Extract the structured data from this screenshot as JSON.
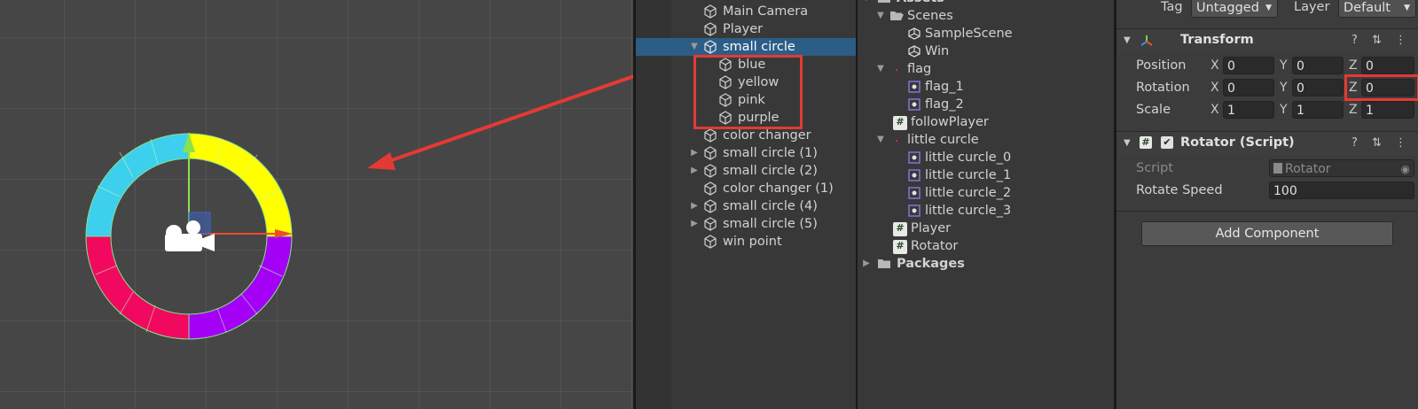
{
  "hierarchy": {
    "items": [
      {
        "label": "Main Camera"
      },
      {
        "label": "Player"
      },
      {
        "label": "small circle"
      },
      {
        "label": "blue"
      },
      {
        "label": "yellow"
      },
      {
        "label": "pink"
      },
      {
        "label": "purple"
      },
      {
        "label": "color changer"
      },
      {
        "label": "small circle (1)"
      },
      {
        "label": "small circle (2)"
      },
      {
        "label": "color changer (1)"
      },
      {
        "label": "small circle (4)"
      },
      {
        "label": "small circle (5)"
      },
      {
        "label": "win point"
      }
    ]
  },
  "project": {
    "root": "Assets",
    "items": [
      {
        "label": "Scenes"
      },
      {
        "label": "SampleScene"
      },
      {
        "label": "Win"
      },
      {
        "label": "flag"
      },
      {
        "label": "flag_1"
      },
      {
        "label": "flag_2"
      },
      {
        "label": "followPlayer"
      },
      {
        "label": "little curcle"
      },
      {
        "label": "little curcle_0"
      },
      {
        "label": "little curcle_1"
      },
      {
        "label": "little curcle_2"
      },
      {
        "label": "little curcle_3"
      },
      {
        "label": "Player"
      },
      {
        "label": "Rotator"
      },
      {
        "label": "Packages"
      }
    ]
  },
  "inspector": {
    "tag_label": "Tag",
    "tag_value": "Untagged",
    "layer_label": "Layer",
    "layer_value": "Default",
    "transform": {
      "title": "Transform",
      "position_label": "Position",
      "rotation_label": "Rotation",
      "scale_label": "Scale",
      "x": "X",
      "y": "Y",
      "z": "Z",
      "position": [
        "0",
        "0",
        "0"
      ],
      "rotation": [
        "0",
        "0",
        "0"
      ],
      "scale": [
        "1",
        "1",
        "1"
      ]
    },
    "rotator": {
      "title": "Rotator (Script)",
      "script_label": "Script",
      "script_value": "Rotator",
      "speed_label": "Rotate Speed",
      "speed_value": "100"
    },
    "add_component": "Add Component"
  },
  "colors": {
    "selection": "#2c5d87",
    "highlight_box": "#e53935",
    "ring_cyan": "#3dcfee",
    "ring_yellow": "#ffff00",
    "ring_pink": "#f0095f",
    "ring_purple": "#a300f5"
  }
}
